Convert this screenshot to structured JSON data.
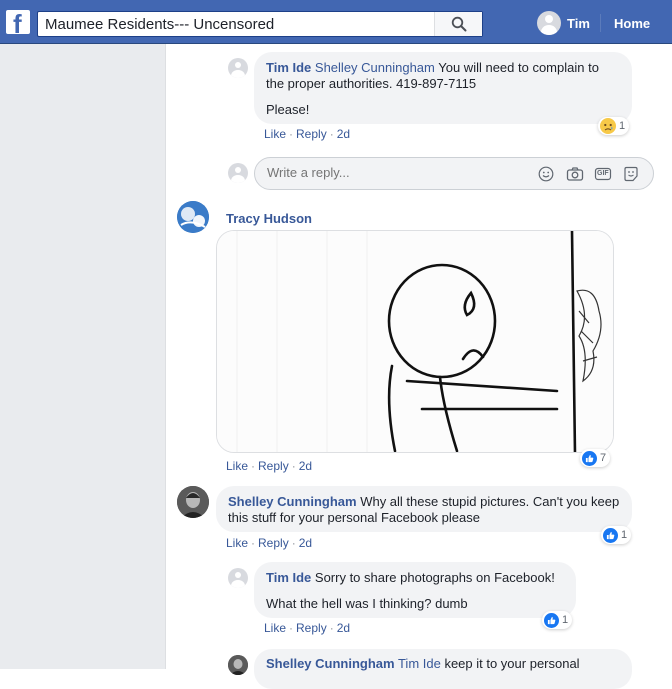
{
  "header": {
    "logo_icon": "facebook-f-logo",
    "search_value": "Maumee Residents--- Uncensored",
    "search_icon": "search-icon",
    "user_name": "Tim",
    "home_label": "Home"
  },
  "comments": [
    {
      "author": "Tim Ide",
      "mention": "Shelley Cunningham",
      "text_line1": " You will need to complain to the proper authorities. 419-897-7115",
      "text_line2": "Please!",
      "like": "Like",
      "reply": "Reply",
      "time": "2d",
      "reaction_icon": "sad-emoji",
      "reaction_count": "1"
    },
    {
      "author": "Tracy Hudson",
      "like": "Like",
      "reply": "Reply",
      "time": "2d",
      "reaction_icon": "like-icon",
      "reaction_count": "7"
    },
    {
      "author": "Shelley Cunningham",
      "text": " Why all these stupid pictures. Can't you keep this stuff for your personal Facebook please",
      "like": "Like",
      "reply": "Reply",
      "time": "2d",
      "reaction_icon": "like-icon",
      "reaction_count": "1"
    },
    {
      "author": "Tim Ide",
      "text_line1": " Sorry to share photographs on Facebook!",
      "text_line2": "What the hell was I thinking? dumb",
      "like": "Like",
      "reply": "Reply",
      "time": "2d",
      "reaction_icon": "like-icon",
      "reaction_count": "1"
    },
    {
      "author": "Shelley Cunningham",
      "mention": "Tim Ide",
      "text": " keep it to your personal"
    }
  ],
  "reply_box": {
    "placeholder": "Write a reply...",
    "tools": [
      "emoji-icon",
      "camera-icon",
      "gif-icon",
      "sticker-icon"
    ],
    "gif_label": "GIF"
  },
  "colors": {
    "brand": "#4267b2",
    "link": "#385898",
    "bubble": "#f2f3f5",
    "like_blue": "#1877f2"
  }
}
